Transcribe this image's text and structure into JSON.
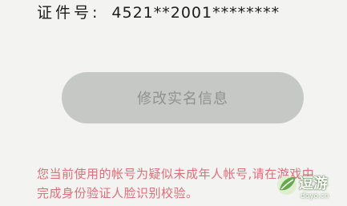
{
  "identity": {
    "label": "证件号:",
    "value": "4521**2001********"
  },
  "actions": {
    "modify_label": "修改实名信息"
  },
  "notice": {
    "text": "您当前使用的帐号为疑似未成年人帐号,请在游戏中完成身份验证人脸识别校验。"
  },
  "watermark": {
    "name": "逗游",
    "domain": "doyo.cn",
    "logo_icon": "green-leaf-logo-icon"
  },
  "colors": {
    "background": "#f3f3f1",
    "button_fill": "#c6c8c5",
    "button_text": "#8f918e",
    "notice_text": "#dc6f78",
    "watermark_green": "#6aa84f"
  }
}
